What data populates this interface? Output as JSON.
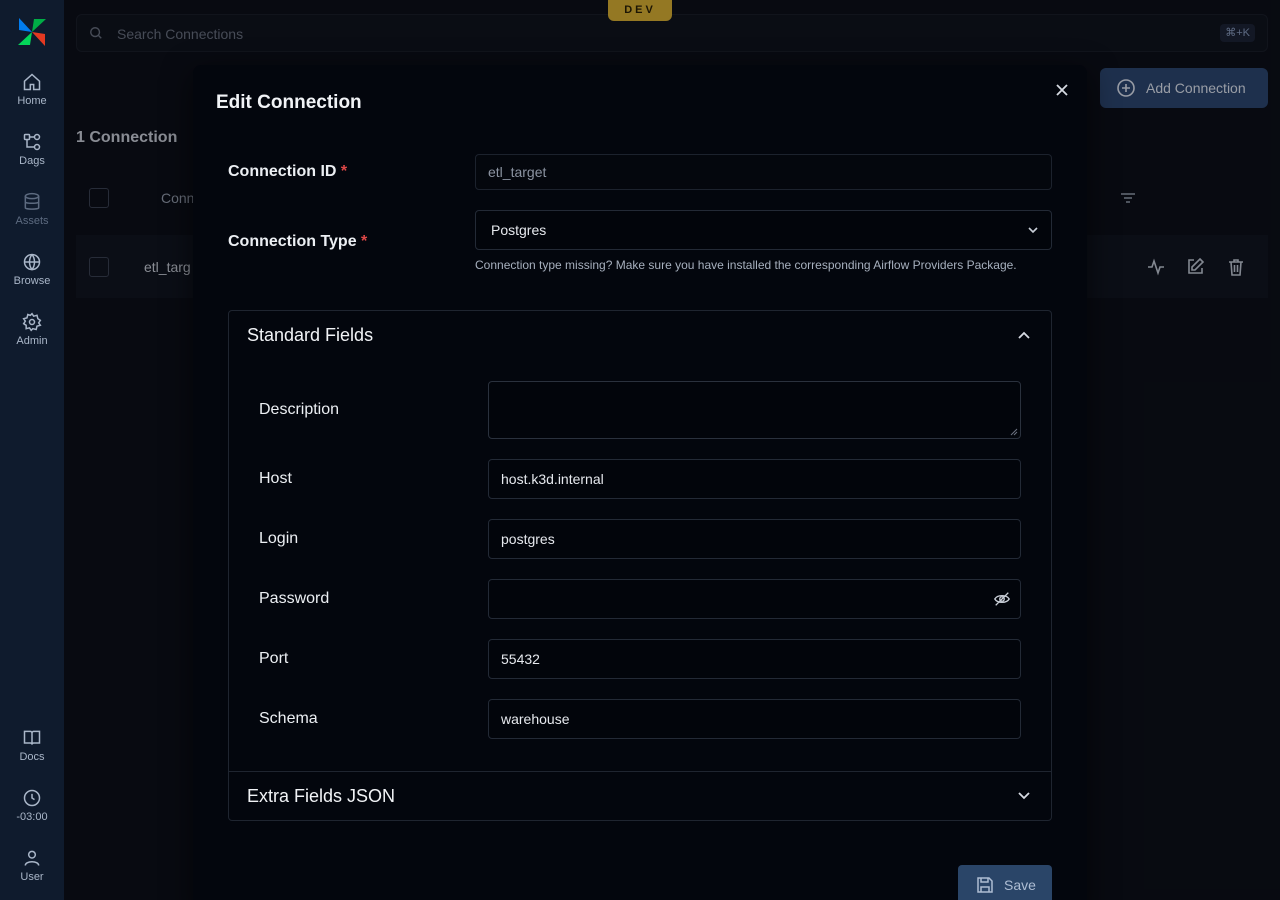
{
  "env_badge": "DEV",
  "search": {
    "placeholder": "Search Connections",
    "shortcut": "⌘+K"
  },
  "sidebar": {
    "items": [
      {
        "label": "Home",
        "icon": "home-icon"
      },
      {
        "label": "Dags",
        "icon": "dags-icon"
      },
      {
        "label": "Assets",
        "icon": "assets-icon"
      },
      {
        "label": "Browse",
        "icon": "globe-icon"
      },
      {
        "label": "Admin",
        "icon": "gear-icon"
      }
    ],
    "bottom_items": [
      {
        "label": "Docs",
        "icon": "book-icon"
      },
      {
        "label": "-03:00",
        "icon": "clock-icon"
      },
      {
        "label": "User",
        "icon": "user-icon"
      }
    ]
  },
  "page": {
    "count_title": "1 Connection",
    "add_button": "Add Connection",
    "table_header_first": "Conn",
    "row": {
      "id_partial": "etl_targ"
    }
  },
  "modal": {
    "title": "Edit Connection",
    "connection_id": {
      "label": "Connection ID",
      "required": "*",
      "value": "etl_target"
    },
    "connection_type": {
      "label": "Connection Type",
      "required": "*",
      "value": "Postgres",
      "hint": "Connection type missing? Make sure you have installed the corresponding Airflow Providers Package."
    },
    "standard_fields": {
      "title": "Standard Fields",
      "description_label": "Description",
      "description_value": "",
      "host_label": "Host",
      "host_value": "host.k3d.internal",
      "login_label": "Login",
      "login_value": "postgres",
      "password_label": "Password",
      "password_value": "",
      "port_label": "Port",
      "port_value": "55432",
      "schema_label": "Schema",
      "schema_value": "warehouse"
    },
    "extra_fields": {
      "title": "Extra Fields JSON"
    },
    "save_button": "Save"
  },
  "colors": {
    "sidebar_bg": "#0f1b2d",
    "primary_button": "#2b4770",
    "dev_badge": "#e0b531",
    "required": "#e04848"
  }
}
